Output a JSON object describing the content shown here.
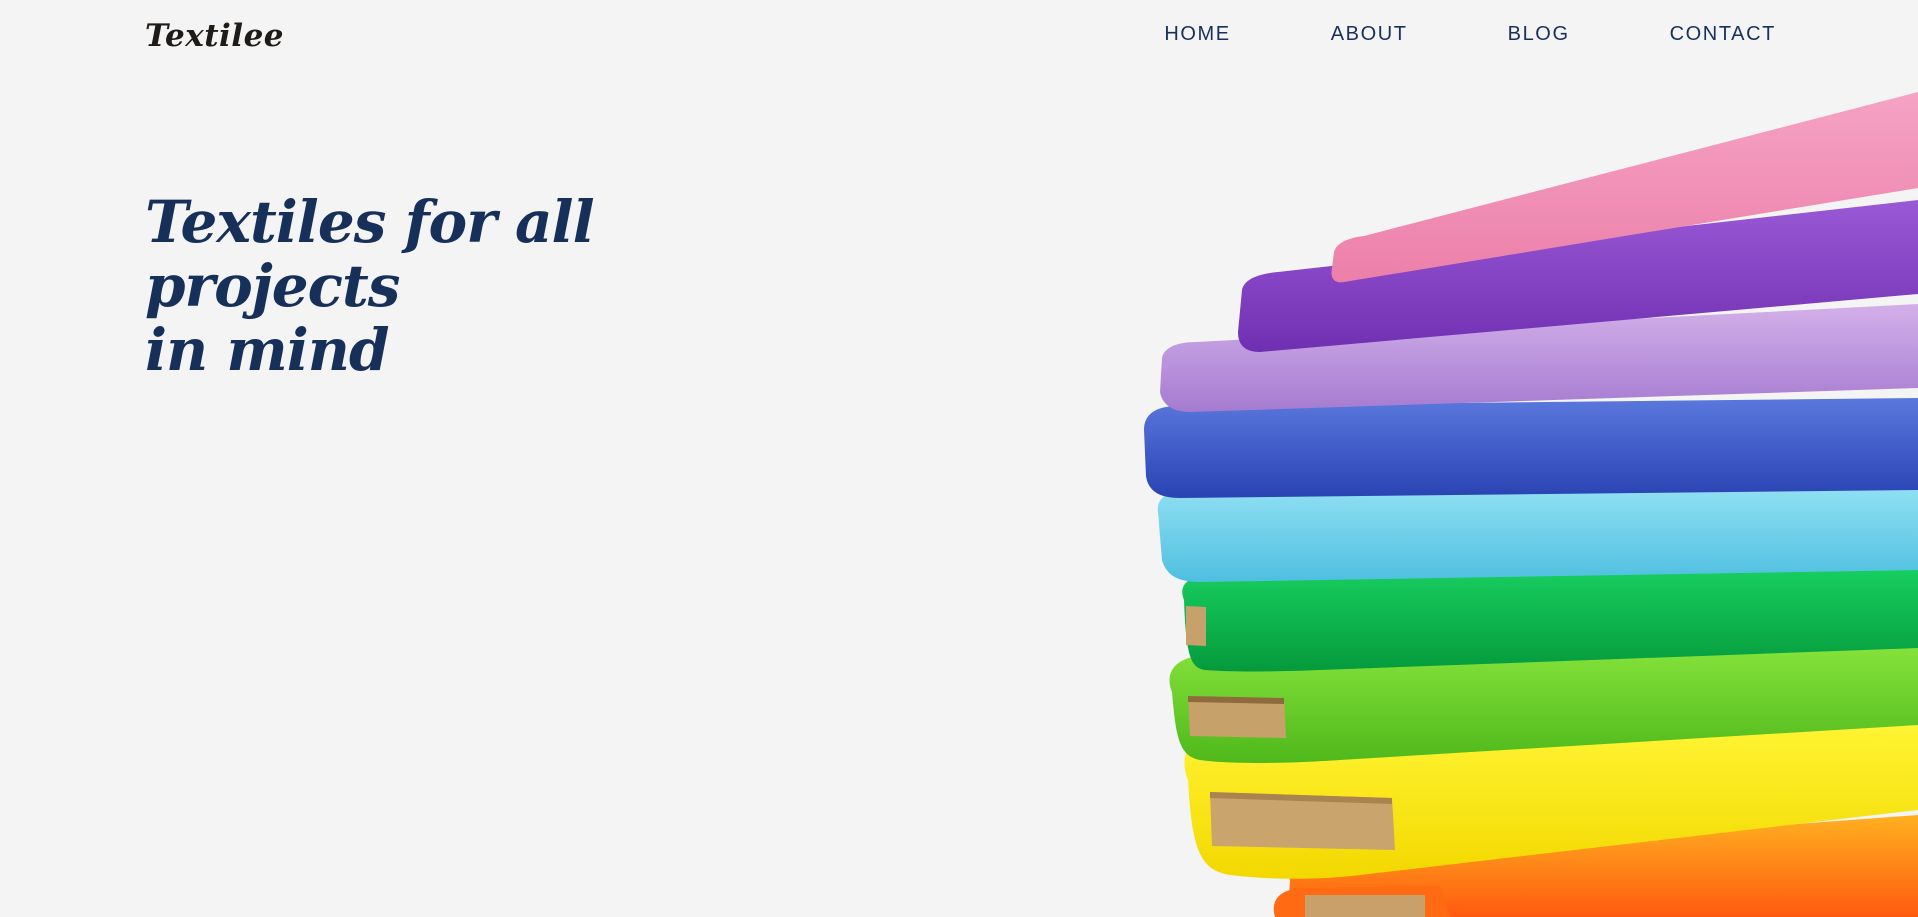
{
  "header": {
    "logo": "Textilee",
    "nav": [
      {
        "label": "HOME"
      },
      {
        "label": "ABOUT"
      },
      {
        "label": "BLOG"
      },
      {
        "label": "CONTACT"
      }
    ]
  },
  "hero": {
    "heading_line1": "Textiles for all projects",
    "heading_line2": "in mind",
    "image": "stacked-fabric-rolls"
  },
  "colors": {
    "background": "#f4f4f4",
    "heading": "#17305a",
    "nav": "#16325c",
    "logo": "#1e1b18",
    "fabrics": [
      "#f08db3",
      "#8a45c8",
      "#c59ae0",
      "#3f5ccc",
      "#6fd0ea",
      "#0bbb4e",
      "#6cd42b",
      "#fff100",
      "#ff7a1a"
    ]
  }
}
